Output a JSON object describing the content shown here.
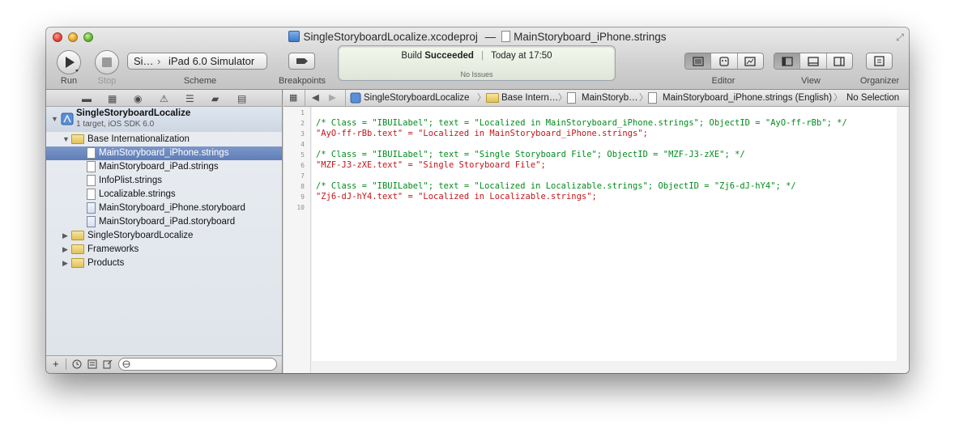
{
  "window": {
    "title_project": "SingleStoryboardLocalize.xcodeproj",
    "title_separator": "—",
    "title_file": "MainStoryboard_iPhone.strings"
  },
  "toolbar": {
    "run_label": "Run",
    "stop_label": "Stop",
    "scheme_target": "Si…",
    "scheme_destination": "iPad 6.0 Simulator",
    "scheme_label": "Scheme",
    "breakpoints_label": "Breakpoints",
    "editor_label": "Editor",
    "view_label": "View",
    "organizer_label": "Organizer"
  },
  "activity": {
    "status_prefix": "Build",
    "status_bold": "Succeeded",
    "time": "Today at 17:50",
    "issues": "No Issues"
  },
  "navigator": {
    "project_name": "SingleStoryboardLocalize",
    "project_subtitle": "1 target, iOS SDK 6.0",
    "tree": [
      {
        "label": "Base Internationalization",
        "kind": "folder",
        "expanded": true
      },
      {
        "label": "MainStoryboard_iPhone.strings",
        "kind": "file",
        "selected": true
      },
      {
        "label": "MainStoryboard_iPad.strings",
        "kind": "file"
      },
      {
        "label": "InfoPlist.strings",
        "kind": "file"
      },
      {
        "label": "Localizable.strings",
        "kind": "file"
      },
      {
        "label": "MainStoryboard_iPhone.storyboard",
        "kind": "storyboard"
      },
      {
        "label": "MainStoryboard_iPad.storyboard",
        "kind": "storyboard"
      },
      {
        "label": "SingleStoryboardLocalize",
        "kind": "folder",
        "expanded": false
      },
      {
        "label": "Frameworks",
        "kind": "folder",
        "expanded": false
      },
      {
        "label": "Products",
        "kind": "folder",
        "expanded": false
      }
    ]
  },
  "jumpbar": {
    "items": [
      "SingleStoryboardLocalize",
      "Base Intern…",
      "MainStoryb…",
      "MainStoryboard_iPhone.strings (English)",
      "No Selection"
    ]
  },
  "editor": {
    "line_numbers": [
      "1",
      "2",
      "3",
      "4",
      "5",
      "6",
      "7",
      "8",
      "9",
      "10"
    ],
    "lines": [
      {
        "kind": "blank",
        "text": ""
      },
      {
        "kind": "comment",
        "text": "/* Class = \"IBUILabel\"; text = \"Localized in MainStoryboard_iPhone.strings\"; ObjectID = \"AyO-ff-rBb\"; */"
      },
      {
        "kind": "string",
        "text": "\"AyO-ff-rBb.text\" = \"Localized in MainStoryboard_iPhone.strings\";"
      },
      {
        "kind": "blank",
        "text": ""
      },
      {
        "kind": "comment",
        "text": "/* Class = \"IBUILabel\"; text = \"Single Storyboard File\"; ObjectID = \"MZF-J3-zXE\"; */"
      },
      {
        "kind": "string",
        "text": "\"MZF-J3-zXE.text\" = \"Single Storyboard File\";"
      },
      {
        "kind": "blank",
        "text": ""
      },
      {
        "kind": "comment",
        "text": "/* Class = \"IBUILabel\"; text = \"Localized in Localizable.strings\"; ObjectID = \"Zj6-dJ-hY4\"; */"
      },
      {
        "kind": "string",
        "text": "\"Zj6-dJ-hY4.text\" = \"Localized in Localizable.strings\";"
      },
      {
        "kind": "blank",
        "text": ""
      }
    ]
  },
  "icons": {
    "add": "+",
    "recent": "clock-icon",
    "filter": "filter-icon",
    "search_field": "search-field"
  }
}
